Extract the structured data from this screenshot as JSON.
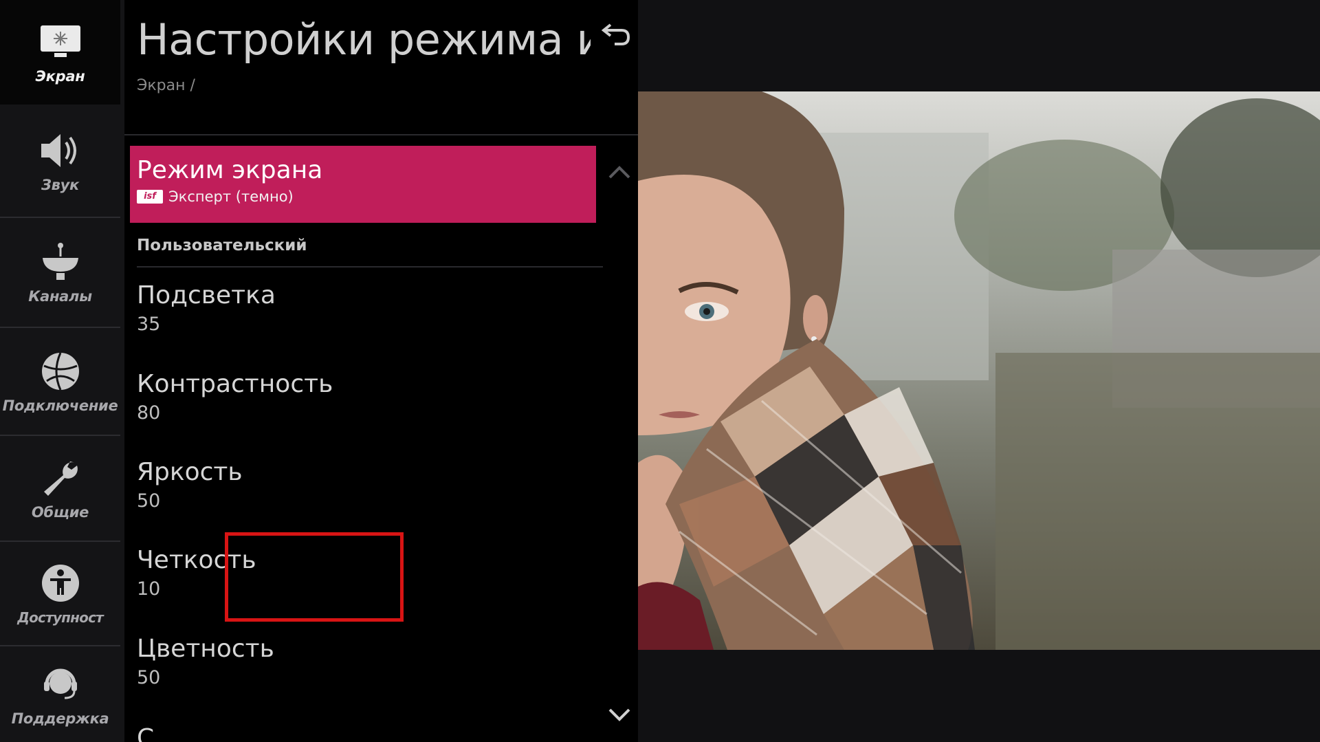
{
  "sidebar": {
    "items": [
      {
        "label": "Экран",
        "icon": "monitor-icon",
        "active": true
      },
      {
        "label": "Звук",
        "icon": "speaker-icon"
      },
      {
        "label": "Каналы",
        "icon": "satellite-dish-icon"
      },
      {
        "label": "Подключение",
        "icon": "globe-icon"
      },
      {
        "label": "Общие",
        "icon": "wrench-icon"
      },
      {
        "label": "Доступност",
        "icon": "accessibility-icon"
      },
      {
        "label": "Поддержка",
        "icon": "support-headset-icon"
      }
    ]
  },
  "panel": {
    "title": "Настройки режима изображения",
    "breadcrumb": "Экран /",
    "selected": {
      "title": "Режим экрана",
      "badge": "isf",
      "subtitle": "Эксперт (темно)"
    },
    "section_label": "Пользовательский",
    "items": [
      {
        "name": "Подсветка",
        "value": "35"
      },
      {
        "name": "Контрастность",
        "value": "80"
      },
      {
        "name": "Яркость",
        "value": "50"
      },
      {
        "name": "Четкость",
        "value": "10"
      },
      {
        "name": "Цветность",
        "value": "50"
      }
    ],
    "next_item_partial": "С"
  },
  "colors": {
    "accent": "#c01e5a",
    "highlight_box": "#d81414"
  },
  "preview": {
    "description_icon": "photo-preview"
  }
}
